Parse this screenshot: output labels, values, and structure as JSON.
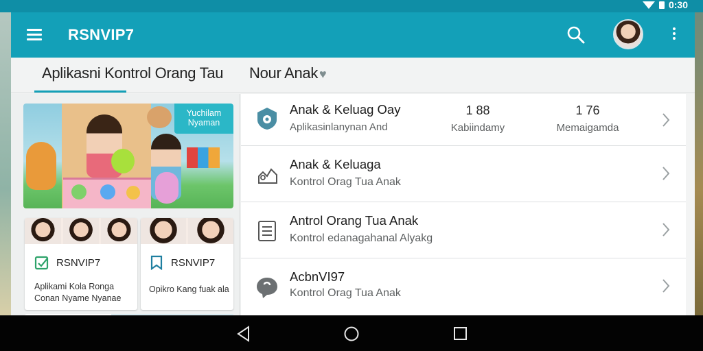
{
  "status_bar": {
    "time": "0:30"
  },
  "app_bar": {
    "title": "RSNVIP7",
    "icons": [
      "menu-icon",
      "search-icon",
      "avatar",
      "more-vert-icon"
    ],
    "color": "#13a0b8"
  },
  "tabs": [
    {
      "label": "Aplikasni Kontrol Orang Tau",
      "selected": true
    },
    {
      "label": "Nour Anak",
      "icon": "heart-icon",
      "selected": false
    }
  ],
  "hero": {
    "badge": "Yuchilam Nyaman"
  },
  "cards": [
    {
      "title": "RSNVIP7",
      "icon": "check-square-icon",
      "text": "Aplikami Kola Ronga Conan Nyame Nyanae"
    },
    {
      "title": "RSNVIP7",
      "icon": "bookmark-icon",
      "text": "Opikro Kang fuak ala"
    }
  ],
  "list": [
    {
      "icon": "shield-gear-icon",
      "title": "Anak & Keluag Oay",
      "subtitle": "Aplikasinlanynan And",
      "stats": [
        {
          "value": "1 88",
          "label": "Kabiindamy"
        },
        {
          "value": "1 76",
          "label": "Memaigamda"
        }
      ]
    },
    {
      "icon": "family-icon",
      "title": "Anak & Keluaga",
      "subtitle": "Kontrol Orag Tua Anak"
    },
    {
      "icon": "list-icon",
      "title": "Antrol Orang Tua Anak",
      "subtitle": "Kontrol edanagahanal Alyakg"
    },
    {
      "icon": "chat-icon",
      "title": "AcbnVI97",
      "subtitle": "Kontrol Orag Tua Anak"
    }
  ],
  "nav": {
    "icons": [
      "back-icon",
      "home-icon",
      "recents-icon"
    ]
  }
}
